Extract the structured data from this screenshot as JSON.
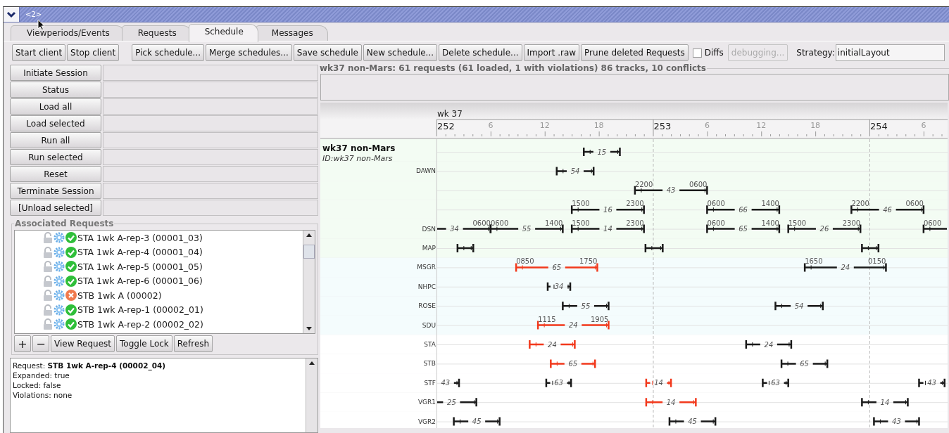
{
  "window": {
    "title": "<2>"
  },
  "tabs": [
    {
      "label": "Viewperiods/Events",
      "selected": false
    },
    {
      "label": "Requests",
      "selected": false
    },
    {
      "label": "Schedule",
      "selected": true
    },
    {
      "label": "Messages",
      "selected": false
    }
  ],
  "toolbar": {
    "client_buttons": [
      "Start client",
      "Stop client"
    ],
    "schedule_buttons": [
      "Pick schedule...",
      "Merge schedules...",
      "Save schedule",
      "New schedule...",
      "Delete schedule...",
      "Import .raw",
      "Prune deleted Requests"
    ],
    "diffs": {
      "label": "Diffs",
      "checked": false
    },
    "debug_button": {
      "label": "debugging...",
      "disabled": true
    },
    "strategy": {
      "label": "Strategy:",
      "value": "initialLayout"
    }
  },
  "session_buttons": [
    "Initiate Session",
    "Status",
    "Load all",
    "Load selected",
    "Run all",
    "Run selected",
    "Reset",
    "Terminate Session",
    "[Unload selected]"
  ],
  "associated_requests": {
    "title": "Associated Requests",
    "items": [
      {
        "text": "STA 1wk A-rep-3 (00001_03)",
        "kind": "ok",
        "locked": false
      },
      {
        "text": "STA 1wk A-rep-4 (00001_04)",
        "kind": "ok",
        "locked": false
      },
      {
        "text": "STA 1wk A-rep-5 (00001_05)",
        "kind": "ok",
        "locked": false
      },
      {
        "text": "STA 1wk A-rep-6 (00001_06)",
        "kind": "ok",
        "locked": false
      },
      {
        "text": "STB 1wk A (00002)",
        "kind": "error",
        "locked": false
      },
      {
        "text": "STB 1wk A-rep-1 (00002_01)",
        "kind": "ok",
        "locked": false
      },
      {
        "text": "STB 1wk A-rep-2 (00002_02)",
        "kind": "ok",
        "locked": false
      }
    ],
    "buttons": [
      {
        "label": "+",
        "kind": "icon"
      },
      {
        "label": "−",
        "kind": "icon"
      },
      {
        "label": "View Request",
        "kind": "text"
      },
      {
        "label": "Toggle Lock",
        "kind": "text"
      },
      {
        "label": "Refresh",
        "kind": "text"
      }
    ]
  },
  "details": [
    "Request: **STB 1wk A-rep-4 (00002_04)**",
    "Expanded: true",
    "Locked: false",
    "Violations: none"
  ],
  "schedule": {
    "title": "wk37 non-Mars: 61 requests (61 loaded, 1 with violations) 86 tracks, 10 conflicts",
    "week_label": "wk 37",
    "group": {
      "name": "wk37 non-Mars",
      "id": "ID:wk37 non-Mars"
    },
    "days": [
      {
        "label": "252",
        "hours": [
          "6",
          "12",
          "18"
        ]
      },
      {
        "label": "253",
        "hours": [
          "6",
          "12",
          "18"
        ]
      },
      {
        "label": "254",
        "hours": [
          "6"
        ]
      }
    ],
    "rows": [
      {
        "color": "#f3fcf3",
        "segments": [
          {
            "label": "15",
            "conflict": false
          }
        ]
      },
      {
        "label": "DAWN",
        "color": "#f3fcf3",
        "segments": [
          {
            "label": "54",
            "conflict": false
          }
        ]
      },
      {
        "color": "#f3fcf3",
        "segments": [
          {
            "label": "43",
            "start_label": "2200",
            "end_label": "0600",
            "conflict": false
          }
        ]
      },
      {
        "color": "#f3fcf3",
        "segments": [
          {
            "label": "16",
            "start_label": "1500",
            "end_label": "2300",
            "conflict": false
          },
          {
            "label": "66",
            "start_label": "0600",
            "end_label": "1400",
            "conflict": false
          },
          {
            "label": "46",
            "start_label": "2200",
            "end_label": "0600",
            "conflict": false
          }
        ]
      },
      {
        "label": "DSN",
        "color": "#f3fcf3",
        "segments": [
          {
            "label": "34",
            "end_label": "0600",
            "conflict": false
          },
          {
            "label": "55",
            "start_label": "0600",
            "end_label": "1400",
            "conflict": false
          },
          {
            "label": "14",
            "start_label": "1500",
            "end_label": "2300",
            "conflict": false
          },
          {
            "label": "65",
            "start_label": "0600",
            "end_label": "1400",
            "conflict": false
          },
          {
            "label": "26",
            "start_label": "1500",
            "end_label": "2300",
            "conflict": false
          },
          {
            "start_label": "0600",
            "conflict": false
          }
        ]
      },
      {
        "label": "MAP",
        "color": "#f3fcf3",
        "segments": [
          {
            "conflict": false
          },
          {
            "conflict": false
          },
          {
            "conflict": false
          }
        ]
      },
      {
        "label": "MSGR",
        "color": "#f4fcfd",
        "segments": [
          {
            "label": "65",
            "start_label": "0850",
            "end_label": "1750",
            "conflict": true
          },
          {
            "label": "24",
            "start_label": "1650",
            "end_label": "0150",
            "conflict": false
          }
        ]
      },
      {
        "label": "NHPC",
        "color": "#f4fcfd",
        "segments": [
          {
            "label": "34",
            "conflict": false
          }
        ]
      },
      {
        "label": "ROSE",
        "color": "#f4fcfd",
        "segments": [
          {
            "label": "55",
            "conflict": false
          },
          {
            "label": "54",
            "conflict": false
          }
        ]
      },
      {
        "label": "SDU",
        "color": "#f4fcfd",
        "segments": [
          {
            "label": "24",
            "start_label": "1115",
            "end_label": "1905",
            "conflict": true
          }
        ]
      },
      {
        "label": "STA",
        "color": "#ffffff",
        "segments": [
          {
            "label": "24",
            "conflict": true
          },
          {
            "label": "24",
            "conflict": false
          }
        ]
      },
      {
        "label": "STB",
        "color": "#ffffff",
        "segments": [
          {
            "label": "65",
            "conflict": true
          },
          {
            "label": "65",
            "conflict": false
          }
        ]
      },
      {
        "label": "STF",
        "color": "#ffffff",
        "segments": [
          {
            "label": "43",
            "conflict": false
          },
          {
            "label": "63",
            "conflict": false
          },
          {
            "label": "14",
            "conflict": true
          },
          {
            "label": "63",
            "conflict": false
          },
          {
            "label": "43",
            "conflict": false
          }
        ]
      },
      {
        "label": "VGR1",
        "color": "#ffffff",
        "segments": [
          {
            "label": "25",
            "conflict": false
          },
          {
            "label": "14",
            "conflict": true
          },
          {
            "label": "14",
            "conflict": false
          }
        ]
      },
      {
        "label": "VGR2",
        "color": "#ffffff",
        "segments": [
          {
            "label": "45",
            "conflict": false
          },
          {
            "label": "45",
            "conflict": false
          },
          {
            "label": "43",
            "conflict": false
          }
        ]
      }
    ]
  }
}
